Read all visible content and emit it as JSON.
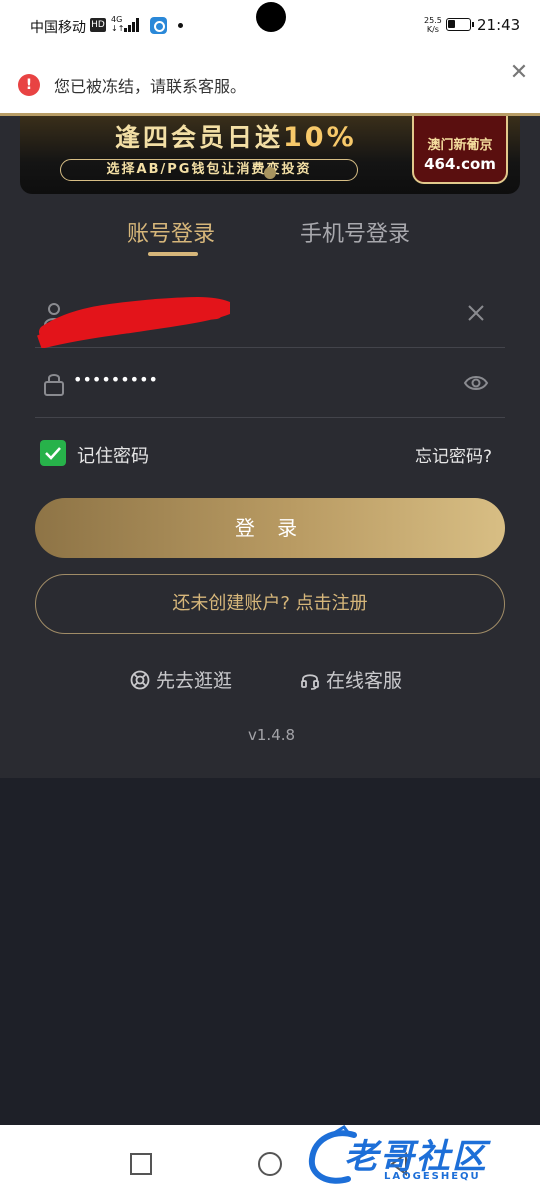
{
  "status_bar": {
    "carrier": "中国移动",
    "hd": "HD",
    "network": "4G",
    "network_sub": "↓↑",
    "speed_value": "25.5",
    "speed_unit": "K/s",
    "time": "21:43"
  },
  "notice": {
    "message": "您已被冻结，请联系客服。"
  },
  "banner": {
    "headline_a": "逢四会员日送",
    "headline_b": "10%",
    "subline": "选择AB/PG钱包让消费变投资",
    "logo_title": "澳门新葡京",
    "logo_site": "464.com"
  },
  "tabs": {
    "account_login": "账号登录",
    "phone_login": "手机号登录"
  },
  "form": {
    "password_value": "•••••••••",
    "remember_label": "记住密码",
    "remember_checked": true,
    "forgot_label": "忘记密码?",
    "login_button": "登 录",
    "register_button": "还未创建账户? 点击注册"
  },
  "links": {
    "browse": "先去逛逛",
    "service": "在线客服"
  },
  "version": "v1.4.8",
  "watermark": {
    "title": "老哥社区",
    "sub": "LAOGESHEQU"
  },
  "colors": {
    "accent_gold": "#d6b67a",
    "panel_bg": "#2a2b31",
    "page_bg": "#1e2028",
    "error_red": "#e84343",
    "check_green": "#27b24a"
  }
}
